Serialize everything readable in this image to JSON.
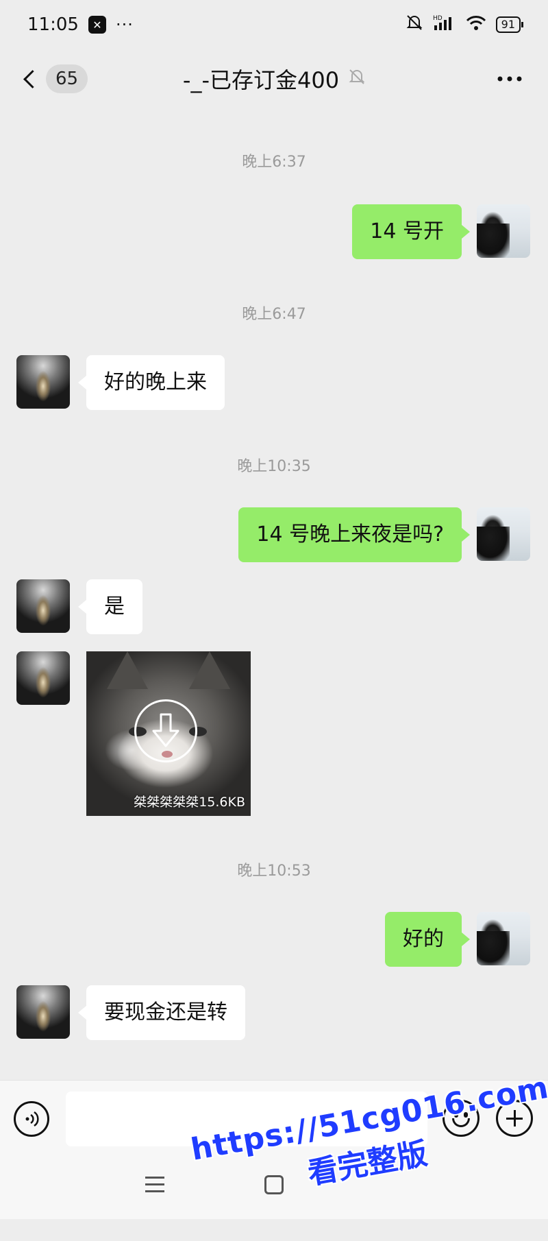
{
  "status_bar": {
    "time": "11:05",
    "app_badge": "✕",
    "more": "···",
    "network": "HD",
    "battery": "91"
  },
  "header": {
    "unread_count": "65",
    "title": "-_-已存订金400"
  },
  "messages": [
    {
      "type": "time",
      "text": "晚上6:37"
    },
    {
      "type": "text",
      "from": "me",
      "text": "14 号开"
    },
    {
      "type": "time",
      "text": "晚上6:47"
    },
    {
      "type": "text",
      "from": "other",
      "text": "好的晚上来"
    },
    {
      "type": "time",
      "text": "晚上10:35"
    },
    {
      "type": "text",
      "from": "me",
      "text": "14 号晚上来夜是吗?"
    },
    {
      "type": "text",
      "from": "other",
      "text": "是"
    },
    {
      "type": "sticker",
      "from": "other",
      "caption": "桀桀桀桀桀",
      "size": "15.6KB"
    },
    {
      "type": "time",
      "text": "晚上10:53"
    },
    {
      "type": "text",
      "from": "me",
      "text": "好的"
    },
    {
      "type": "text",
      "from": "other",
      "text": "要现金还是转"
    }
  ],
  "input": {
    "value": "",
    "placeholder": ""
  },
  "icons": {
    "back": "chevron-left-icon",
    "mute": "bell-off-icon",
    "more": "more-horizontal-icon",
    "voice": "voice-icon",
    "emoji": "emoji-icon",
    "plus": "plus-icon",
    "download": "download-icon"
  },
  "colors": {
    "my_bubble": "#95ec69",
    "their_bubble": "#ffffff",
    "background": "#ededed",
    "watermark": "#1f3cff"
  },
  "watermark": {
    "url": "https://51cg016.com",
    "subtitle": "看完整版"
  }
}
